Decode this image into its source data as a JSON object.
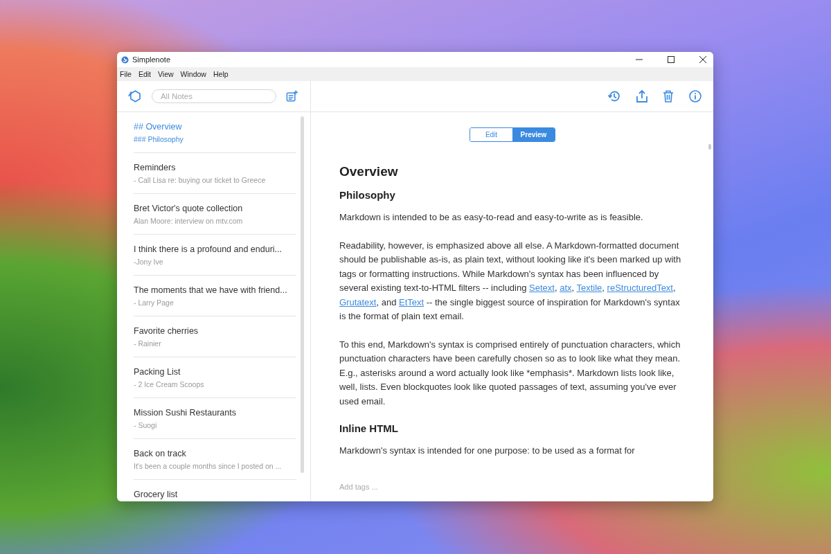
{
  "window": {
    "title": "Simplenote"
  },
  "menu": [
    "File",
    "Edit",
    "View",
    "Window",
    "Help"
  ],
  "search": {
    "placeholder": "All Notes"
  },
  "notes": [
    {
      "title": "## Overview",
      "preview": "### Philosophy",
      "selected": true
    },
    {
      "title": "Reminders",
      "preview": "- Call Lisa re: buying our ticket to Greece",
      "selected": false
    },
    {
      "title": "Bret Victor's quote collection",
      "preview": "Alan Moore: interview on mtv.com",
      "selected": false
    },
    {
      "title": "I think there is a profound and enduri...",
      "preview": "-Jony Ive",
      "selected": false
    },
    {
      "title": "The moments that we have with friend...",
      "preview": "- Larry Page",
      "selected": false
    },
    {
      "title": "Favorite cherries",
      "preview": "- Rainier",
      "selected": false
    },
    {
      "title": "Packing List",
      "preview": "- 2 Ice Cream Scoops",
      "selected": false
    },
    {
      "title": "Mission Sushi Restaurants",
      "preview": "- Suogi",
      "selected": false
    },
    {
      "title": "Back on track",
      "preview": "It's been a couple months since I posted on ...",
      "selected": false
    },
    {
      "title": "Grocery list",
      "selected": false
    }
  ],
  "mode_tabs": [
    {
      "label": "Edit",
      "selected": false
    },
    {
      "label": "Preview",
      "selected": true
    }
  ],
  "content": [
    {
      "kind": "h1",
      "parts": [
        {
          "text": "Overview",
          "link": false
        }
      ]
    },
    {
      "kind": "h2",
      "parts": [
        {
          "text": "Philosophy",
          "link": false
        }
      ]
    },
    {
      "kind": "p",
      "parts": [
        {
          "text": "Markdown is intended to be as easy-to-read and easy-to-write as is feasible.",
          "link": false
        }
      ]
    },
    {
      "kind": "p",
      "parts": [
        {
          "text": "Readability, however, is emphasized above all else. A Markdown-formatted document should be publishable as-is, as plain text, without looking like it's been marked up with tags or formatting instructions. While Markdown's syntax has been influenced by several existing text-to-HTML filters -- including ",
          "link": false
        },
        {
          "text": "Setext",
          "link": true
        },
        {
          "text": ", ",
          "link": false
        },
        {
          "text": "atx",
          "link": true
        },
        {
          "text": ", ",
          "link": false
        },
        {
          "text": "Textile",
          "link": true
        },
        {
          "text": ", ",
          "link": false
        },
        {
          "text": "reStructuredText",
          "link": true
        },
        {
          "text": ", ",
          "link": false
        },
        {
          "text": "Grutatext",
          "link": true
        },
        {
          "text": ", and ",
          "link": false
        },
        {
          "text": "EtText",
          "link": true
        },
        {
          "text": " -- the single biggest source of inspiration for Markdown's syntax is the format of plain text email.",
          "link": false
        }
      ]
    },
    {
      "kind": "p",
      "parts": [
        {
          "text": "To this end, Markdown's syntax is comprised entirely of punctuation characters, which punctuation characters have been carefully chosen so as to look like what they mean. E.g., asterisks around a word actually look like *emphasis*. Markdown lists look like, well, lists. Even blockquotes look like quoted passages of text, assuming you've ever used email.",
          "link": false
        }
      ]
    },
    {
      "kind": "h2",
      "parts": [
        {
          "text": "Inline HTML",
          "link": false
        }
      ]
    },
    {
      "kind": "p",
      "parts": [
        {
          "text": "Markdown's syntax is intended for one purpose: to be used as a format for",
          "link": false
        }
      ]
    }
  ],
  "tags": {
    "placeholder": "Add tags ..."
  }
}
